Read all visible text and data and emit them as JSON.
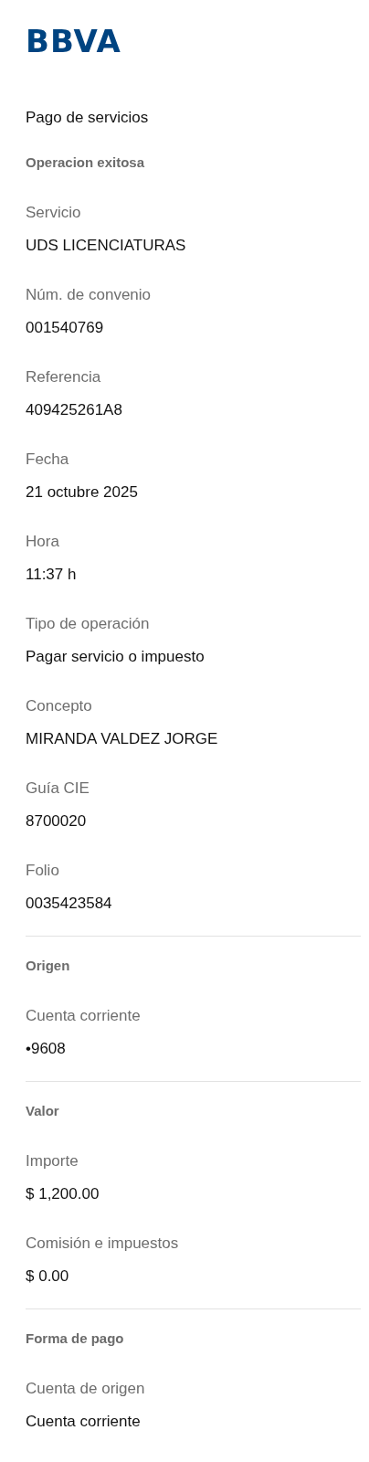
{
  "logo": "BBVA",
  "title": "Pago de servicios",
  "sections": [
    {
      "heading": "Operacion exitosa",
      "fields": [
        {
          "label": "Servicio",
          "value": "UDS LICENCIATURAS"
        },
        {
          "label": "Núm. de convenio",
          "value": "001540769"
        },
        {
          "label": "Referencia",
          "value": "409425261A8"
        },
        {
          "label": "Fecha",
          "value": "21 octubre 2025"
        },
        {
          "label": "Hora",
          "value": "11:37 h"
        },
        {
          "label": "Tipo de operación",
          "value": "Pagar servicio o impuesto"
        },
        {
          "label": "Concepto",
          "value": "MIRANDA VALDEZ JORGE"
        },
        {
          "label": "Guía CIE",
          "value": "8700020"
        },
        {
          "label": "Folio",
          "value": "0035423584"
        }
      ]
    },
    {
      "heading": "Origen",
      "fields": [
        {
          "label": "Cuenta corriente",
          "value": "•9608"
        }
      ]
    },
    {
      "heading": "Valor",
      "fields": [
        {
          "label": "Importe",
          "value": "$ 1,200.00"
        },
        {
          "label": "Comisión e impuestos",
          "value": "$ 0.00"
        }
      ]
    },
    {
      "heading": "Forma de pago",
      "fields": [
        {
          "label": "Cuenta de origen",
          "value": "Cuenta corriente"
        }
      ]
    }
  ]
}
